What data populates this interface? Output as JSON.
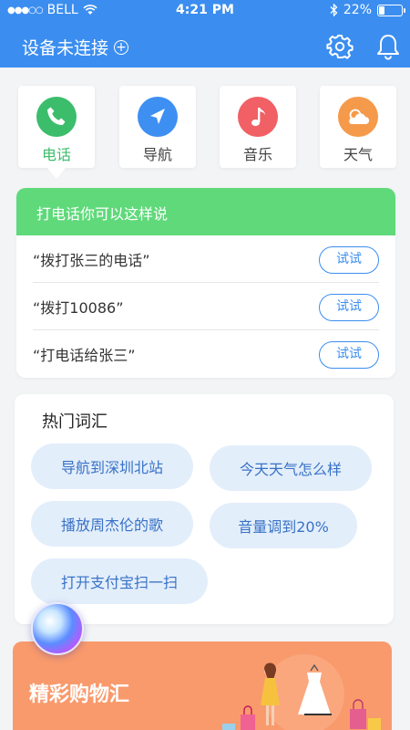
{
  "status_bar": {
    "signal": "●●●○○",
    "carrier": "BELL",
    "time": "4:21 PM",
    "battery": "22%",
    "battery_level": 0.22
  },
  "header": {
    "title": "设备未连接",
    "add_icon": "plus-circle-icon",
    "settings_icon": "gear-icon",
    "notification_icon": "bell-icon"
  },
  "tabs": [
    {
      "label": "电话",
      "icon": "phone-icon",
      "color": "#3cbd6c",
      "active": true
    },
    {
      "label": "导航",
      "icon": "navigation-arrow-icon",
      "color": "#3d8ff2",
      "active": false
    },
    {
      "label": "音乐",
      "icon": "music-note-icon",
      "color": "#f06065",
      "active": false
    },
    {
      "label": "天气",
      "icon": "cloud-sun-icon",
      "color": "#f59a4a",
      "active": false
    }
  ],
  "command_card": {
    "heading": "打电话你可以这样说",
    "items": [
      {
        "text": "“拨打张三的电话”",
        "button": "试试"
      },
      {
        "text": "“拨打10086”",
        "button": "试试"
      },
      {
        "text": "“打电话给张三”",
        "button": "试试"
      }
    ]
  },
  "hot_words": {
    "title": "热门词汇",
    "chips": [
      "导航到深圳北站",
      "今天天气怎么样",
      "播放周杰伦的歌",
      "音量调到20%",
      "打开支付宝扫一扫"
    ]
  },
  "shopping_banner": {
    "title": "精彩购物汇"
  },
  "colors": {
    "brand_blue": "#3b8ef0",
    "green": "#5fd97a",
    "chip_bg": "#e3eefb",
    "banner_orange": "#f99a6c"
  }
}
